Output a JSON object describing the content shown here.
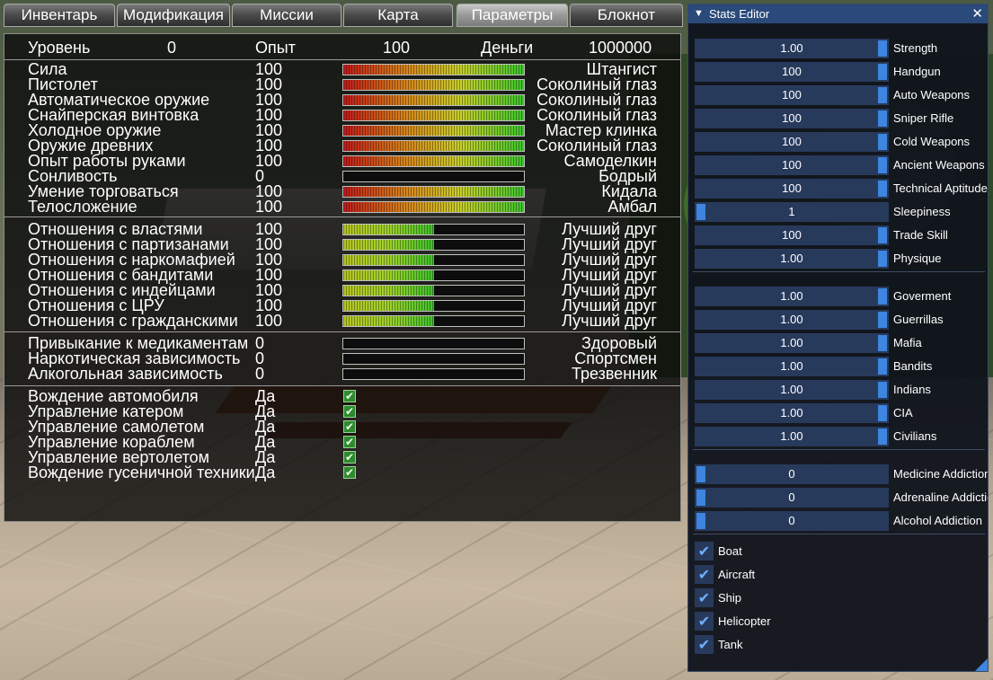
{
  "tabs": [
    "Инвентарь",
    "Модификация",
    "Миссии",
    "Карта",
    "Параметры",
    "Блокнот"
  ],
  "active_tab": "Параметры",
  "header": {
    "level_label": "Уровень",
    "level_value": "0",
    "exp_label": "Опыт",
    "exp_value": "100",
    "money_label": "Деньги",
    "money_value": "1000000"
  },
  "skills": [
    {
      "label": "Сила",
      "value": "100",
      "fill": 1.0,
      "desc": "Штангист"
    },
    {
      "label": "Пистолет",
      "value": "100",
      "fill": 1.0,
      "desc": "Соколиный глаз"
    },
    {
      "label": "Автоматическое оружие",
      "value": "100",
      "fill": 1.0,
      "desc": "Соколиный глаз"
    },
    {
      "label": "Снайперская винтовка",
      "value": "100",
      "fill": 1.0,
      "desc": "Соколиный глаз"
    },
    {
      "label": "Холодное оружие",
      "value": "100",
      "fill": 1.0,
      "desc": "Мастер клинка"
    },
    {
      "label": "Оружие древних",
      "value": "100",
      "fill": 1.0,
      "desc": "Соколиный глаз"
    },
    {
      "label": "Опыт работы руками",
      "value": "100",
      "fill": 1.0,
      "desc": "Самоделкин"
    },
    {
      "label": "Сонливость",
      "value": "0",
      "fill": 0.0,
      "desc": "Бодрый"
    },
    {
      "label": "Умение торговаться",
      "value": "100",
      "fill": 1.0,
      "desc": "Кидала"
    },
    {
      "label": "Телосложение",
      "value": "100",
      "fill": 1.0,
      "desc": "Амбал"
    }
  ],
  "relations": [
    {
      "label": "Отношения с властями",
      "value": "100",
      "fill": 0.5,
      "desc": "Лучший друг"
    },
    {
      "label": "Отношения с партизанами",
      "value": "100",
      "fill": 0.5,
      "desc": "Лучший друг"
    },
    {
      "label": "Отношения с наркомафией",
      "value": "100",
      "fill": 0.5,
      "desc": "Лучший друг"
    },
    {
      "label": "Отношения с бандитами",
      "value": "100",
      "fill": 0.5,
      "desc": "Лучший друг"
    },
    {
      "label": "Отношения с индейцами",
      "value": "100",
      "fill": 0.5,
      "desc": "Лучший друг"
    },
    {
      "label": "Отношения с ЦРУ",
      "value": "100",
      "fill": 0.5,
      "desc": "Лучший друг"
    },
    {
      "label": "Отношения с гражданскими",
      "value": "100",
      "fill": 0.5,
      "desc": "Лучший друг"
    }
  ],
  "addictions": [
    {
      "label": "Привыкание к медикаментам",
      "value": "0",
      "fill": 0.0,
      "desc": "Здоровый"
    },
    {
      "label": "Наркотическая зависимость",
      "value": "0",
      "fill": 0.0,
      "desc": "Спортсмен"
    },
    {
      "label": "Алкогольная зависимость",
      "value": "0",
      "fill": 0.0,
      "desc": "Трезвенник"
    }
  ],
  "vehicles": [
    {
      "label": "Вождение автомобиля",
      "value": "Да",
      "checked": true
    },
    {
      "label": "Управление катером",
      "value": "Да",
      "checked": true
    },
    {
      "label": "Управление самолетом",
      "value": "Да",
      "checked": true
    },
    {
      "label": "Управление кораблем",
      "value": "Да",
      "checked": true
    },
    {
      "label": "Управление вертолетом",
      "value": "Да",
      "checked": true
    },
    {
      "label": "Вождение гусеничной техники",
      "value": "Да",
      "checked": true
    }
  ],
  "editor": {
    "title": "Stats Editor",
    "close_glyph": "✕",
    "collapse_glyph": "▼",
    "check_glyph": "✔",
    "stats": [
      {
        "value": "1.00",
        "label": "Strength",
        "level": 1.0
      },
      {
        "value": "100",
        "label": "Handgun",
        "level": 1.0
      },
      {
        "value": "100",
        "label": "Auto Weapons",
        "level": 1.0
      },
      {
        "value": "100",
        "label": "Sniper Rifle",
        "level": 1.0
      },
      {
        "value": "100",
        "label": "Cold Weapons",
        "level": 1.0
      },
      {
        "value": "100",
        "label": "Ancient Weapons",
        "level": 1.0
      },
      {
        "value": "100",
        "label": "Technical Aptitude",
        "level": 1.0
      },
      {
        "value": "1",
        "label": "Sleepiness",
        "level": 0.0
      },
      {
        "value": "100",
        "label": "Trade Skill",
        "level": 1.0
      },
      {
        "value": "1.00",
        "label": "Physique",
        "level": 1.0
      }
    ],
    "relations": [
      {
        "value": "1.00",
        "label": "Goverment",
        "level": 1.0
      },
      {
        "value": "1.00",
        "label": "Guerrillas",
        "level": 1.0
      },
      {
        "value": "1.00",
        "label": "Mafia",
        "level": 1.0
      },
      {
        "value": "1.00",
        "label": "Bandits",
        "level": 1.0
      },
      {
        "value": "1.00",
        "label": "Indians",
        "level": 1.0
      },
      {
        "value": "1.00",
        "label": "CIA",
        "level": 1.0
      },
      {
        "value": "1.00",
        "label": "Civilians",
        "level": 1.0
      }
    ],
    "addictions": [
      {
        "value": "0",
        "label": "Medicine Addiction",
        "level": 0.0
      },
      {
        "value": "0",
        "label": "Adrenaline Addiction",
        "level": 0.0
      },
      {
        "value": "0",
        "label": "Alcohol Addiction",
        "level": 0.0
      }
    ],
    "vehicles": [
      {
        "label": "Boat",
        "checked": true
      },
      {
        "label": "Aircraft",
        "checked": true
      },
      {
        "label": "Ship",
        "checked": true
      },
      {
        "label": "Helicopter",
        "checked": true
      },
      {
        "label": "Tank",
        "checked": true
      }
    ]
  },
  "colors": {
    "editor_accent": "#3d85e0",
    "editor_title_bar": "#294a7a",
    "slider_bg": "#283a5c",
    "panel_bg": "#0a0a0a",
    "checkbox_green": "#2f8a2f"
  }
}
